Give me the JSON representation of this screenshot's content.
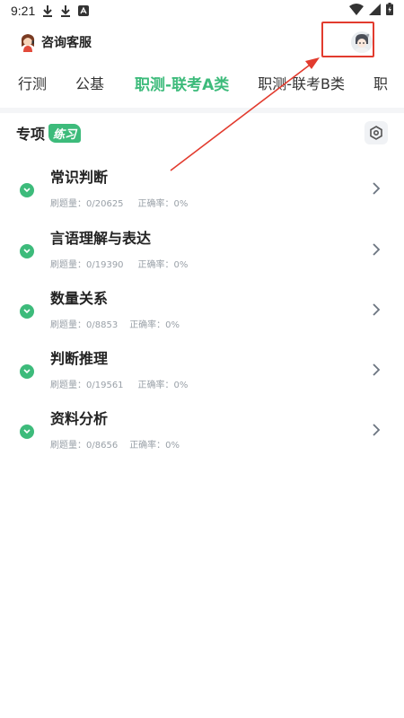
{
  "status_bar": {
    "time": "9:21",
    "left_icons": [
      "download-icon",
      "download-icon",
      "text-notification-icon"
    ],
    "right_icons": [
      "wifi-icon",
      "signal-icon",
      "battery-charging-icon"
    ]
  },
  "header": {
    "service_label": "咨询客服",
    "service_icon": "customer-service-avatar-icon",
    "user_icon": "user-avatar-icon"
  },
  "tabs": [
    {
      "label": "行测",
      "active": false
    },
    {
      "label": "公基",
      "active": false
    },
    {
      "label": "职测-联考A类",
      "active": true
    },
    {
      "label": "职测-联考B类",
      "active": false
    },
    {
      "label": "职",
      "active": false
    }
  ],
  "section": {
    "title": "专项",
    "badge": "练习",
    "settings_icon": "hexagon-settings-icon"
  },
  "practice_items": [
    {
      "title": "常识判断",
      "count_label": "刷题量：0/20625",
      "rate_label": "正确率：0%"
    },
    {
      "title": "言语理解与表达",
      "count_label": "刷题量：0/19390",
      "rate_label": "正确率：0%"
    },
    {
      "title": "数量关系",
      "count_label": "刷题量：0/8853",
      "rate_label": "正确率：0%"
    },
    {
      "title": "判断推理",
      "count_label": "刷题量：0/19561",
      "rate_label": "正确率：0%"
    },
    {
      "title": "资料分析",
      "count_label": "刷题量：0/8656",
      "rate_label": "正确率：0%"
    }
  ],
  "colors": {
    "accent": "#3dbb7b",
    "annotation": "#e23b2e",
    "muted_text": "#9aa1a8"
  }
}
